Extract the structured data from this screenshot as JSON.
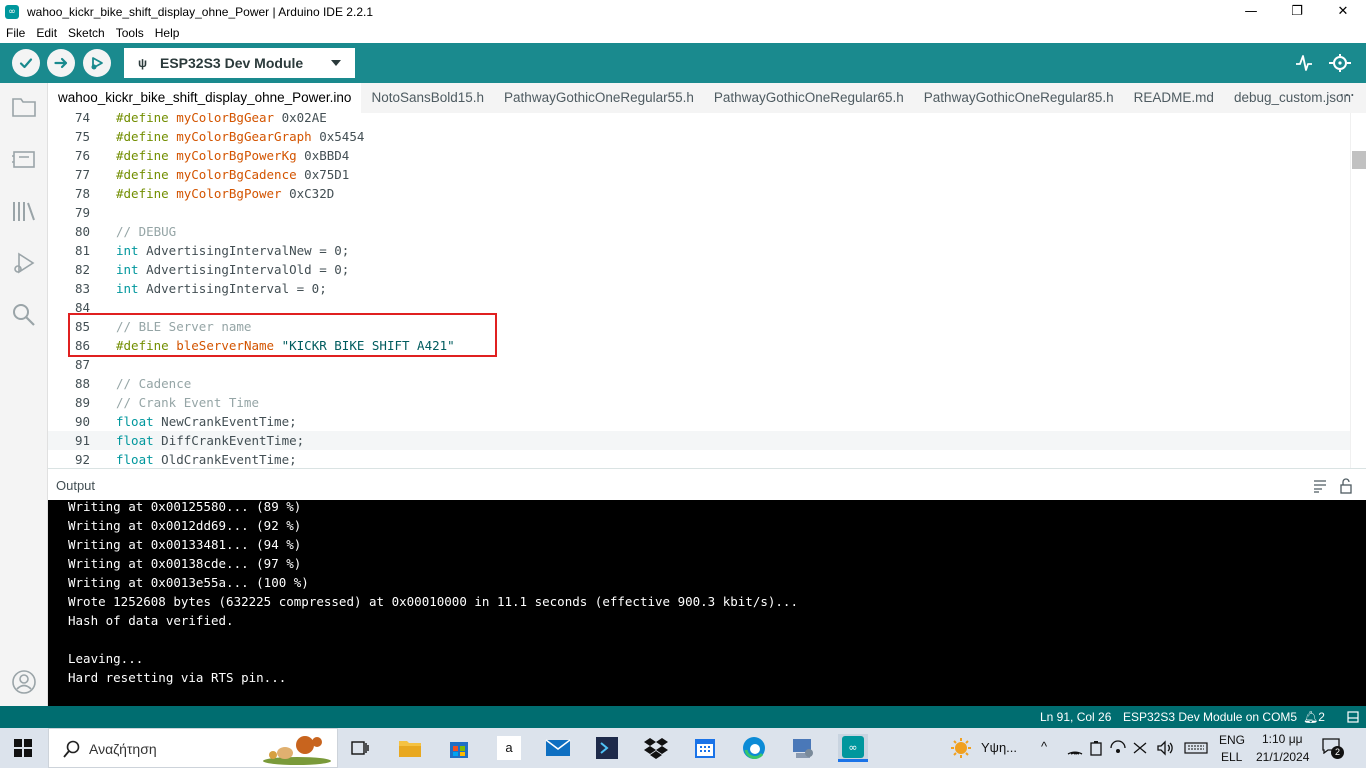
{
  "window": {
    "title": "wahoo_kickr_bike_shift_display_ohne_Power | Arduino IDE 2.2.1",
    "minimize": "—",
    "maximize": "❐",
    "close": "✕"
  },
  "menu": [
    "File",
    "Edit",
    "Sketch",
    "Tools",
    "Help"
  ],
  "toolbar": {
    "board": "ESP32S3 Dev Module",
    "icons": [
      "verify-icon",
      "upload-icon",
      "debug-icon",
      "serial-plotter-icon",
      "serial-monitor-icon"
    ]
  },
  "tabs": [
    "wahoo_kickr_bike_shift_display_ohne_Power.ino",
    "NotoSansBold15.h",
    "PathwayGothicOneRegular55.h",
    "PathwayGothicOneRegular65.h",
    "PathwayGothicOneRegular85.h",
    "README.md",
    "debug_custom.json"
  ],
  "tab_more": "⋯",
  "editor": {
    "lines": [
      {
        "n": "74",
        "tokens": [
          {
            "t": "#define ",
            "c": "pp"
          },
          {
            "t": "myColorBgGear",
            "c": "id"
          },
          {
            "t": " 0x02AE",
            "c": "tx"
          }
        ]
      },
      {
        "n": "75",
        "tokens": [
          {
            "t": "#define ",
            "c": "pp"
          },
          {
            "t": "myColorBgGearGraph",
            "c": "id"
          },
          {
            "t": " 0x5454",
            "c": "tx"
          }
        ]
      },
      {
        "n": "76",
        "tokens": [
          {
            "t": "#define ",
            "c": "pp"
          },
          {
            "t": "myColorBgPowerKg",
            "c": "id"
          },
          {
            "t": " 0xBBD4",
            "c": "tx"
          }
        ]
      },
      {
        "n": "77",
        "tokens": [
          {
            "t": "#define ",
            "c": "pp"
          },
          {
            "t": "myColorBgCadence",
            "c": "id"
          },
          {
            "t": " 0x75D1",
            "c": "tx"
          }
        ]
      },
      {
        "n": "78",
        "tokens": [
          {
            "t": "#define ",
            "c": "pp"
          },
          {
            "t": "myColorBgPower",
            "c": "id"
          },
          {
            "t": " 0xC32D",
            "c": "tx"
          }
        ]
      },
      {
        "n": "79",
        "tokens": []
      },
      {
        "n": "80",
        "tokens": [
          {
            "t": "// DEBUG",
            "c": "cm"
          }
        ]
      },
      {
        "n": "81",
        "tokens": [
          {
            "t": "int",
            "c": "kw"
          },
          {
            "t": " AdvertisingIntervalNew = 0;",
            "c": "tx"
          }
        ]
      },
      {
        "n": "82",
        "tokens": [
          {
            "t": "int",
            "c": "kw"
          },
          {
            "t": " AdvertisingIntervalOld = 0;",
            "c": "tx"
          }
        ]
      },
      {
        "n": "83",
        "tokens": [
          {
            "t": "int",
            "c": "kw"
          },
          {
            "t": " AdvertisingInterval = 0;",
            "c": "tx"
          }
        ]
      },
      {
        "n": "84",
        "tokens": []
      },
      {
        "n": "85",
        "tokens": [
          {
            "t": "// BLE Server name",
            "c": "cm"
          }
        ]
      },
      {
        "n": "86",
        "tokens": [
          {
            "t": "#define ",
            "c": "pp"
          },
          {
            "t": "bleServerName",
            "c": "id"
          },
          {
            "t": " \"KICKR BIKE SHIFT A421\"",
            "c": "str"
          }
        ]
      },
      {
        "n": "87",
        "tokens": []
      },
      {
        "n": "88",
        "tokens": [
          {
            "t": "// Cadence",
            "c": "cm"
          }
        ]
      },
      {
        "n": "89",
        "tokens": [
          {
            "t": "// Crank Event Time",
            "c": "cm"
          }
        ]
      },
      {
        "n": "90",
        "tokens": [
          {
            "t": "float",
            "c": "kw"
          },
          {
            "t": " NewCrankEventTime;",
            "c": "tx"
          }
        ]
      },
      {
        "n": "91",
        "tokens": [
          {
            "t": "float",
            "c": "kw"
          },
          {
            "t": " DiffCrankEventTime;",
            "c": "tx"
          }
        ]
      },
      {
        "n": "92",
        "tokens": [
          {
            "t": "float",
            "c": "kw"
          },
          {
            "t": " OldCrankEventTime;",
            "c": "tx"
          }
        ]
      }
    ],
    "current_line": "91"
  },
  "output": {
    "title": "Output",
    "lines": [
      "Writing at 0x00125580... (89 %)",
      "Writing at 0x0012dd69... (92 %)",
      "Writing at 0x00133481... (94 %)",
      "Writing at 0x00138cde... (97 %)",
      "Writing at 0x0013e55a... (100 %)",
      "Wrote 1252608 bytes (632225 compressed) at 0x00010000 in 11.1 seconds (effective 900.3 kbit/s)...",
      "Hash of data verified.",
      "",
      "Leaving...",
      "Hard resetting via RTS pin..."
    ]
  },
  "status": {
    "position": "Ln 91, Col 26",
    "board_port": "ESP32S3 Dev Module on COM5",
    "notifications": "2"
  },
  "taskbar": {
    "search_placeholder": "Αναζήτηση",
    "weather": "Υψη...",
    "lang_top": "ENG",
    "lang_bottom": "ELL",
    "time": "1:10 μμ",
    "date": "21/1/2024",
    "notification_count": "2"
  },
  "colors": {
    "accent": "#1a8a8e",
    "status_bar": "#006d70",
    "highlight_box": "#e02020"
  }
}
